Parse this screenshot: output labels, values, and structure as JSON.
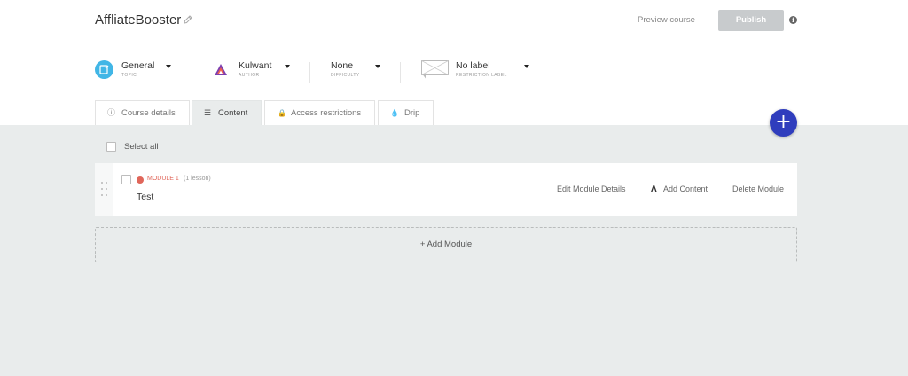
{
  "course": {
    "title": "AffliateBooster"
  },
  "header": {
    "preview_label": "Preview course",
    "publish_label": "Publish",
    "info_glyph": "i"
  },
  "meta": {
    "topic": {
      "value": "General",
      "label": "TOPIC"
    },
    "author": {
      "value": "Kulwant",
      "label": "AUTHOR"
    },
    "difficulty": {
      "value": "None",
      "label": "DIFFICULTY"
    },
    "restriction": {
      "value": "No label",
      "label": "RESTRICTION LABEL"
    }
  },
  "tabs": [
    {
      "label": "Course details",
      "icon": "info-circle-icon",
      "glyph": "ⓘ"
    },
    {
      "label": "Content",
      "icon": "list-icon",
      "glyph": "☰",
      "active": true
    },
    {
      "label": "Access restrictions",
      "icon": "lock-icon",
      "glyph": "🔒"
    },
    {
      "label": "Drip",
      "icon": "drop-icon",
      "glyph": "💧"
    }
  ],
  "fab": {
    "glyph": "+"
  },
  "select_all_label": "Select all",
  "module": {
    "name": "MODULE 1",
    "count": "(1 lesson)",
    "title": "Test",
    "actions": {
      "edit": "Edit Module Details",
      "add": "Add Content",
      "delete": "Delete Module"
    },
    "add_glyph": "Λ"
  },
  "add_module_label": "+ Add Module",
  "colors": {
    "fab": "#2f3dbd",
    "module_dot": "#e0665a",
    "topic_icon": "#41b6e6",
    "content_bg": "#e9ecec"
  }
}
